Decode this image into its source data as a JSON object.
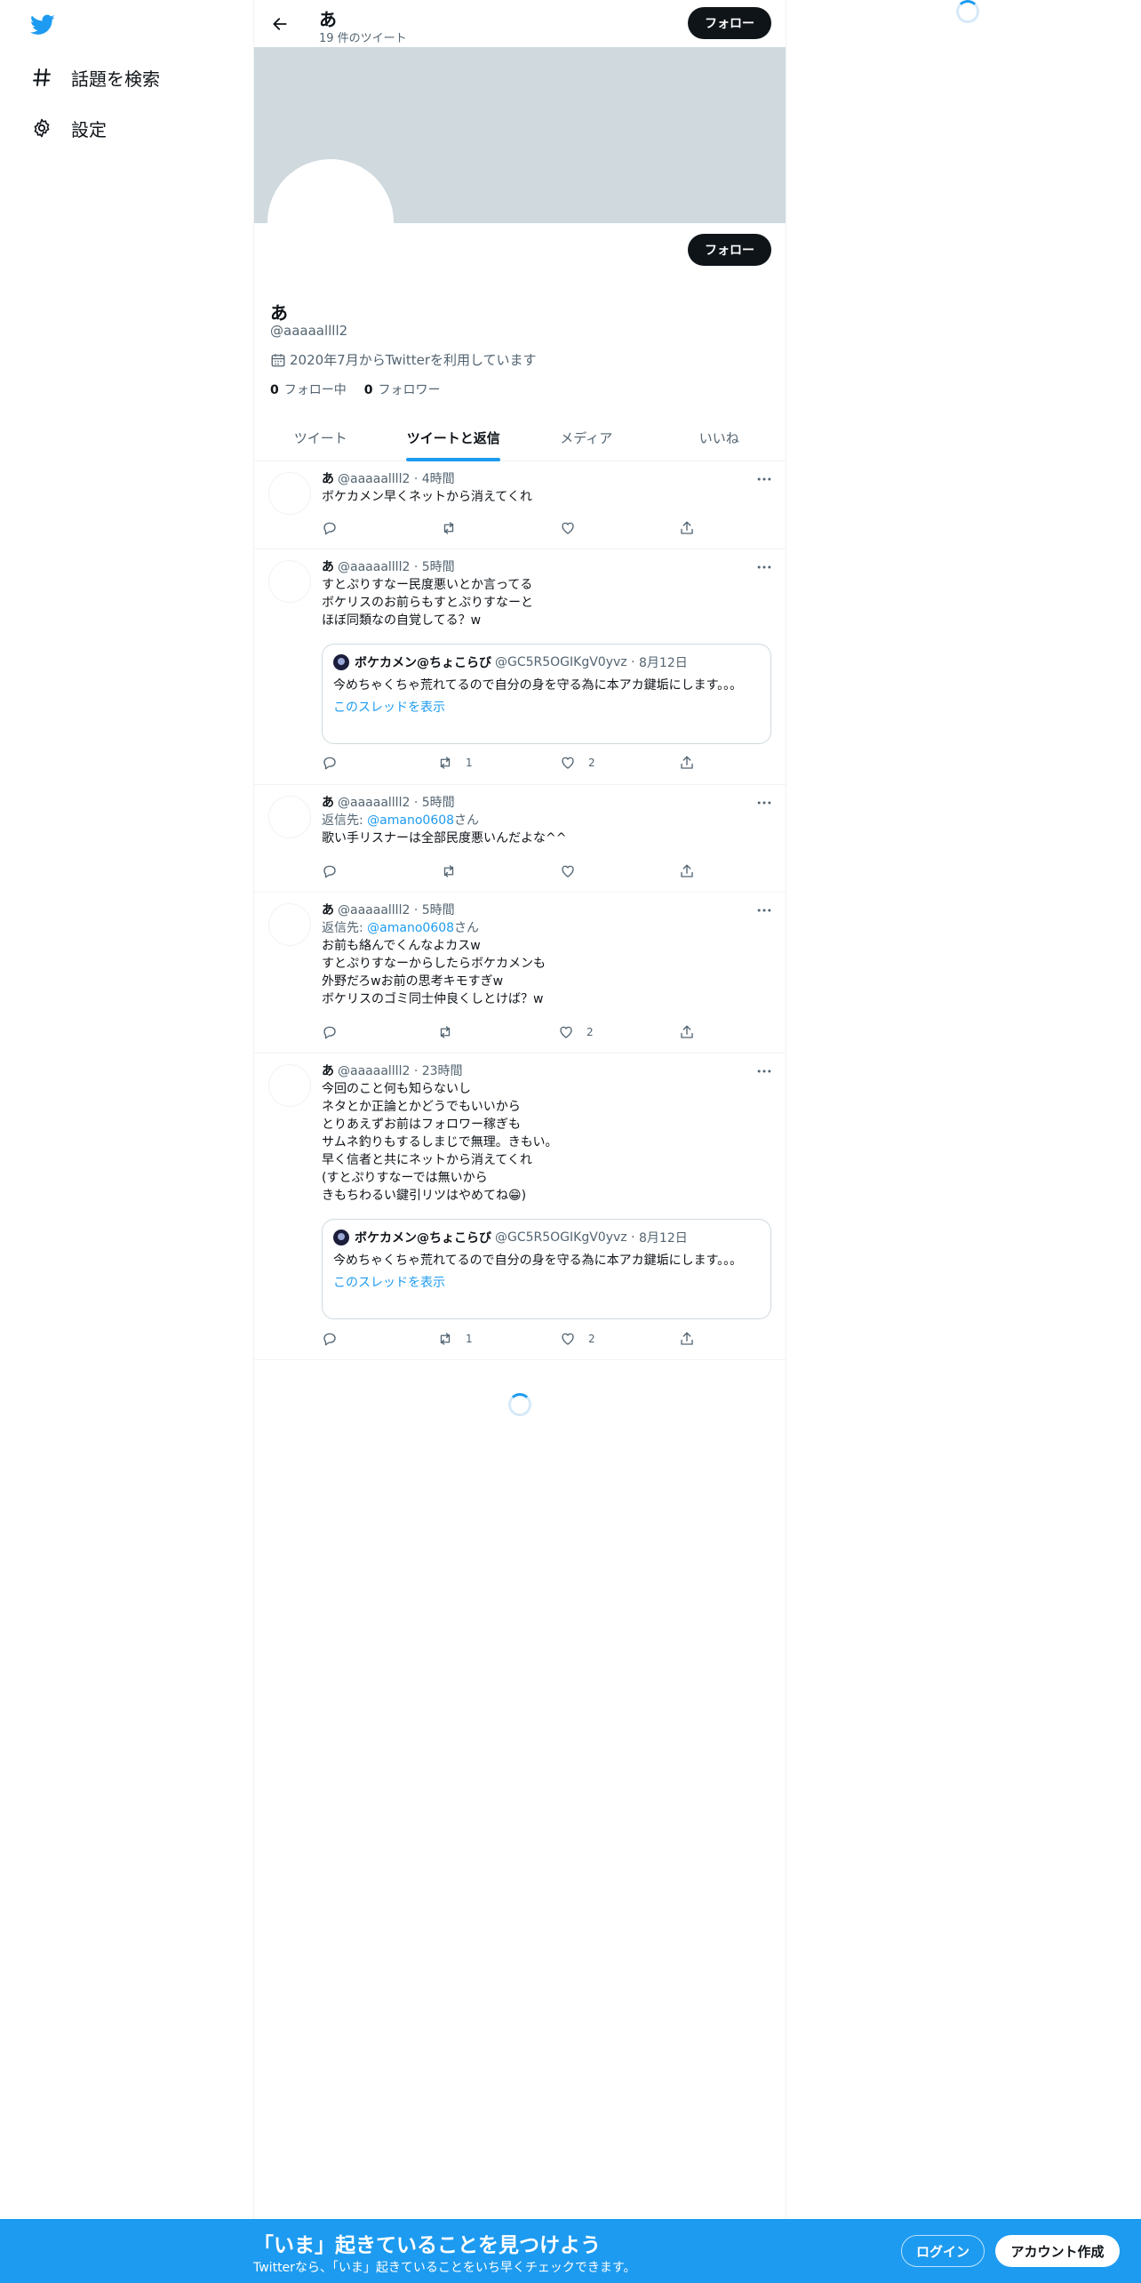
{
  "nav": {
    "items": [
      {
        "label": "話題を検索",
        "icon": "hashtag-icon"
      },
      {
        "label": "設定",
        "icon": "gear-icon"
      }
    ]
  },
  "header": {
    "name": "あ",
    "tweet_count": "19 件のツイート",
    "follow_label": "フォロー"
  },
  "profile": {
    "name": "あ",
    "handle": "@aaaaallll2",
    "joined": "2020年7月からTwitterを利用しています",
    "following_count": "0",
    "following_label": "フォロー中",
    "followers_count": "0",
    "followers_label": "フォロワー",
    "follow_label": "フォロー"
  },
  "tabs": [
    {
      "label": "ツイート"
    },
    {
      "label": "ツイートと返信",
      "active": true
    },
    {
      "label": "メディア"
    },
    {
      "label": "いいね"
    }
  ],
  "tweets": [
    {
      "name": "あ",
      "handle": "@aaaaallll2",
      "time": "4時間",
      "text": "ボケカメン早くネットから消えてくれ",
      "retweets": "",
      "likes": ""
    },
    {
      "name": "あ",
      "handle": "@aaaaallll2",
      "time": "5時間",
      "text": "すとぷりすなー民度悪いとか言ってる\nボケリスのお前らもすとぷりすなーと\nほぼ同類なの自覚してる？w",
      "quote": {
        "name": "ボケカメン@ちょこらび",
        "handle": "@GC5R5OGIKgV0yvz",
        "date": "8月12日",
        "text": "今めちゃくちゃ荒れてるので自分の身を守る為に本アカ鍵垢にします。。。",
        "thread": "このスレッドを表示"
      },
      "retweets": "1",
      "likes": "2"
    },
    {
      "name": "あ",
      "handle": "@aaaaallll2",
      "time": "5時間",
      "reply_to_prefix": "返信先: ",
      "reply_to": "@amano0608",
      "reply_suffix": "さん",
      "text": "歌い手リスナーは全部民度悪いんだよな^^",
      "retweets": "",
      "likes": ""
    },
    {
      "name": "あ",
      "handle": "@aaaaallll2",
      "time": "5時間",
      "reply_to_prefix": "返信先: ",
      "reply_to": "@amano0608",
      "reply_suffix": "さん",
      "text": "お前も絡んでくんなよカスw\nすとぷりすなーからしたらボケカメンも\n外野だろwお前の思考キモすぎw\nボケリスのゴミ同士仲良くしとけば？w",
      "retweets": "",
      "likes": "2"
    },
    {
      "name": "あ",
      "handle": "@aaaaallll2",
      "time": "23時間",
      "text": "今回のこと何も知らないし\nネタとか正論とかどうでもいいから\nとりあえずお前はフォロワー稼ぎも\nサムネ釣りもするしまじで無理。きもい。\n早く信者と共にネットから消えてくれ\n(すとぷりすなーでは無いから\nきもちわるい鍵引リツはやめてね😁)",
      "quote": {
        "name": "ボケカメン@ちょこらび",
        "handle": "@GC5R5OGIKgV0yvz",
        "date": "8月12日",
        "text": "今めちゃくちゃ荒れてるので自分の身を守る為に本アカ鍵垢にします。。。",
        "thread": "このスレッドを表示"
      },
      "retweets": "1",
      "likes": "2"
    }
  ],
  "bottom_bar": {
    "title": "「いま」起きていることを見つけよう",
    "subtitle": "Twitterなら、「いま」起きていることをいち早くチェックできます。",
    "login": "ログイン",
    "signup": "アカウント作成"
  },
  "colors": {
    "accent": "#1d9bf0",
    "banner": "#cfd9de",
    "button_dark": "#0f1419"
  }
}
